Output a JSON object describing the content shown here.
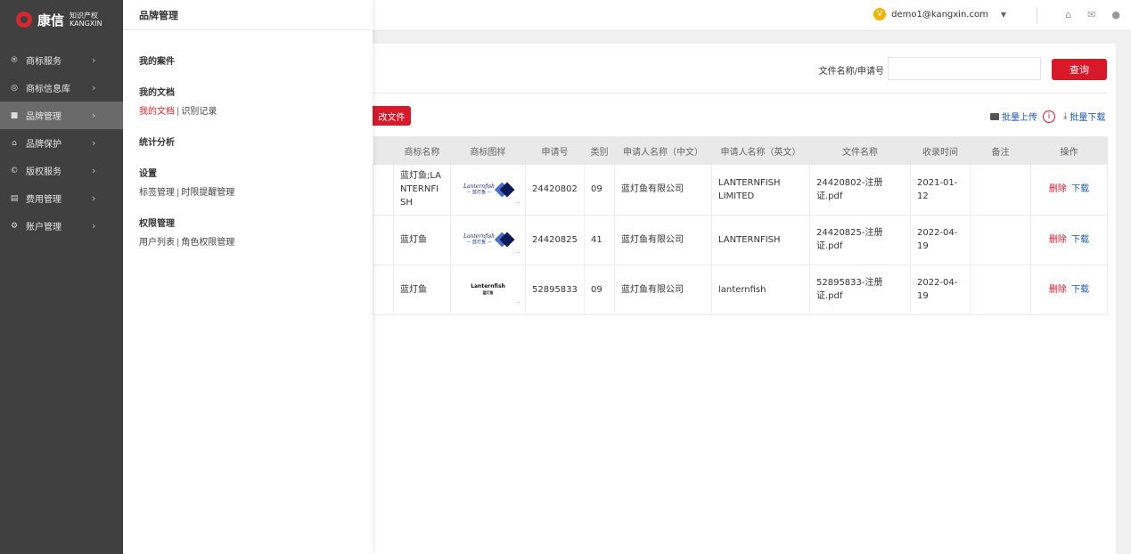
{
  "brand": {
    "name": "康信",
    "sub_cn": "知识产权",
    "sub_en": "KANGXIN"
  },
  "sidebar": {
    "items": [
      {
        "label": "商标服务",
        "icon": "registered-icon"
      },
      {
        "label": "商标信息库",
        "icon": "database-icon"
      },
      {
        "label": "品牌管理",
        "icon": "briefcase-icon",
        "active": true
      },
      {
        "label": "品牌保护",
        "icon": "shield-icon"
      },
      {
        "label": "版权服务",
        "icon": "copyright-icon"
      },
      {
        "label": "费用管理",
        "icon": "ledger-icon"
      },
      {
        "label": "账户管理",
        "icon": "gear-icon"
      }
    ]
  },
  "flyout": {
    "title": "品牌管理",
    "sections": [
      {
        "head": "我的案件",
        "links": []
      },
      {
        "head": "我的文档",
        "links": [
          "我的文档",
          "识别记录"
        ]
      },
      {
        "head": "统计分析",
        "links": []
      },
      {
        "head": "设置",
        "links": [
          "标签管理",
          "时限提醒管理"
        ]
      },
      {
        "head": "权限管理",
        "links": [
          "用户列表",
          "角色权限管理"
        ]
      }
    ],
    "separator": "|"
  },
  "topbar": {
    "user_email": "demo1@kangxin.com",
    "user_badge": "V"
  },
  "search": {
    "label": "文件名称/申请号",
    "value": "",
    "button": "查询"
  },
  "actions": {
    "upload_partial": "改文件",
    "batch_upload": "批量上传",
    "batch_download": "批量下载"
  },
  "table": {
    "headers": [
      "商标名称",
      "商标图样",
      "申请号",
      "类别",
      "申请人名称（中文）",
      "申请人名称（英文）",
      "文件名称",
      "收录时间",
      "备注",
      "操作"
    ],
    "rows": [
      {
        "name": "蓝灯鱼;LANTERNFISH",
        "logo_text": "Lanternfish",
        "logo_sub": "— 蓝灯鱼 —",
        "logo_style": "blue",
        "app_no": "24420802",
        "cls": "09",
        "applicant_cn": "蓝灯鱼有限公司",
        "applicant_en": "LANTERNFISH LIMITED",
        "file": "24420802-注册证.pdf",
        "date": "2021-01-12",
        "note": "",
        "del": "删除",
        "dl": "下载"
      },
      {
        "name": "蓝灯鱼",
        "logo_text": "Lanternfish",
        "logo_sub": "— 蓝灯鱼 —",
        "logo_style": "blue",
        "app_no": "24420825",
        "cls": "41",
        "applicant_cn": "蓝灯鱼有限公司",
        "applicant_en": "LANTERNFISH",
        "file": "24420825-注册证.pdf",
        "date": "2022-04-19",
        "note": "",
        "del": "删除",
        "dl": "下载"
      },
      {
        "name": "蓝灯鱼",
        "logo_text": "Lanternfish",
        "logo_sub": "蓝灯鱼",
        "logo_style": "black",
        "app_no": "52895833",
        "cls": "09",
        "applicant_cn": "蓝灯鱼有限公司",
        "applicant_en": "lanternfish",
        "file": "52895833-注册证.pdf",
        "date": "2022-04-19",
        "note": "",
        "del": "删除",
        "dl": "下载"
      }
    ]
  },
  "colors": {
    "accent_red": "#d7192a",
    "link_blue": "#1e5aa8",
    "sidebar_bg": "#404040"
  }
}
